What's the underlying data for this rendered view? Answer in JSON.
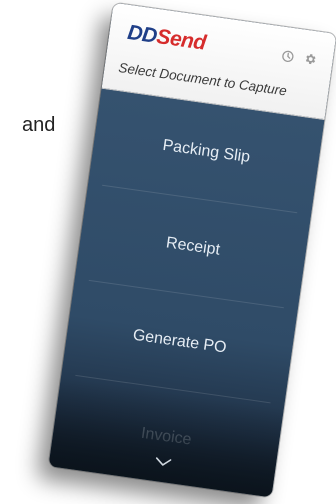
{
  "background": {
    "partial_text": "and"
  },
  "app": {
    "logo_dd": "DD",
    "logo_send": "Send",
    "subtitle": "Select Document to Capture",
    "icons": [
      "history-icon",
      "gear-icon"
    ]
  },
  "documents": [
    {
      "label": "Packing Slip"
    },
    {
      "label": "Receipt"
    },
    {
      "label": "Generate PO"
    },
    {
      "label": "Invoice"
    }
  ],
  "colors": {
    "brand_blue": "#1f3f88",
    "brand_red": "#d62c2c",
    "list_bg": "#2f4b67"
  }
}
